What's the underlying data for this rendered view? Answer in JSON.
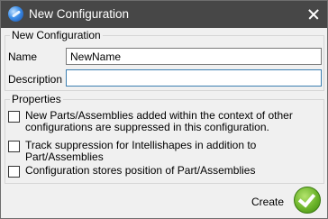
{
  "window": {
    "title": "New Configuration",
    "icon": "solidworks-logo-icon"
  },
  "config_group": {
    "title": "New Configuration",
    "name_label": "Name",
    "name_value": "NewName",
    "description_label": "Description",
    "description_value": ""
  },
  "properties_group": {
    "title": "Properties",
    "options": [
      {
        "label_line1": "New Parts/Assemblies added within the context of other",
        "label_line2": "configurations are suppressed in this configuration.",
        "checked": false
      },
      {
        "label": "Track suppression for Intellishapes in addition to Part/Assemblies",
        "checked": false
      },
      {
        "label": "Configuration stores position of Part/Assemblies",
        "checked": false
      }
    ]
  },
  "actions": {
    "create_label": "Create"
  },
  "colors": {
    "titlebar": "#474747",
    "accent_green": "#6cb42a",
    "focus_border": "#3c7fb1"
  }
}
